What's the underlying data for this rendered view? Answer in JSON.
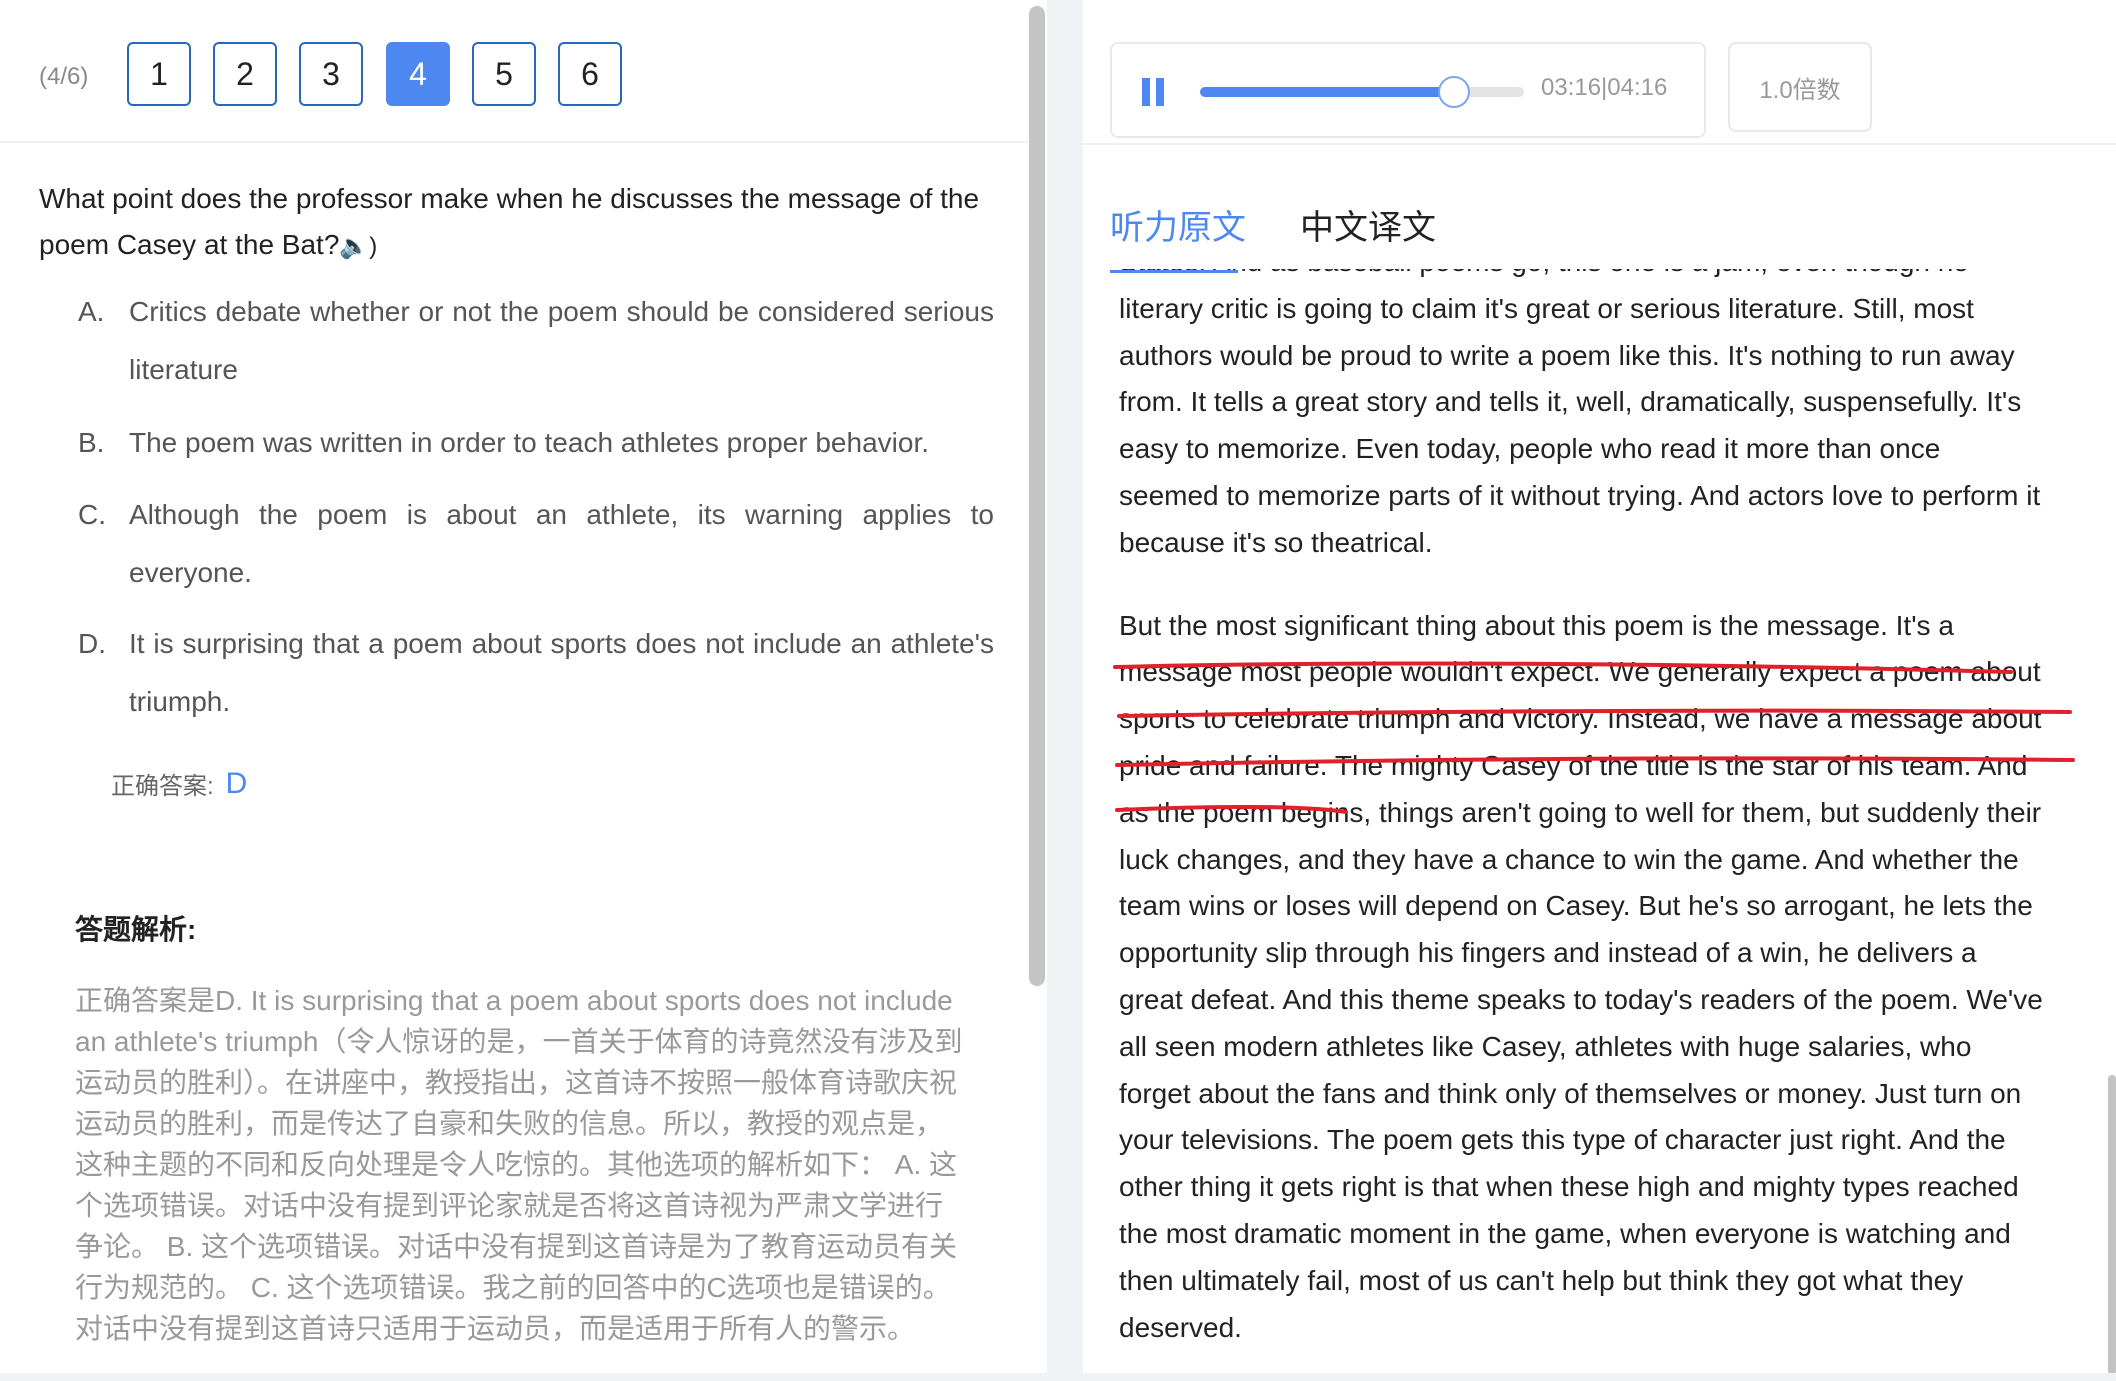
{
  "question_nav": {
    "progress": "(4/6)",
    "buttons": [
      "1",
      "2",
      "3",
      "4",
      "5",
      "6"
    ],
    "active": "4"
  },
  "question": {
    "text": "What point does the professor make when he discusses the message of the poem Casey at the Bat?",
    "speaker_icon": "speaker-icon"
  },
  "options": [
    {
      "letter": "A.",
      "text": "Critics debate whether or not the poem should be considered serious literature"
    },
    {
      "letter": "B.",
      "text": "The poem was written in order to teach athletes proper behavior."
    },
    {
      "letter": "C.",
      "text": "Although the poem is about an athlete, its warning applies to everyone."
    },
    {
      "letter": "D.",
      "text": "It is surprising that a poem about sports does not include an athlete's triumph."
    }
  ],
  "answer": {
    "label": "正确答案:",
    "value": "D"
  },
  "analysis": {
    "heading": "答题解析:",
    "text": "正确答案是D. It is surprising that a poem about sports does not include an athlete's triumph（令人惊讶的是，一首关于体育的诗竟然没有涉及到运动员的胜利）。在讲座中，教授指出，这首诗不按照一般体育诗歌庆祝运动员的胜利，而是传达了自豪和失败的信息。所以，教授的观点是，这种主题的不同和反向处理是令人吃惊的。其他选项的解析如下： A. 这个选项错误。对话中没有提到评论家就是否将这首诗视为严肃文学进行争论。 B. 这个选项错误。对话中没有提到这首诗是为了教育运动员有关行为规范的。 C. 这个选项错误。我之前的回答中的C选项也是错误的。对话中没有提到这首诗只适用于运动员，而是适用于所有人的警示。"
  },
  "player": {
    "time": "03:16|04:16",
    "progress_fraction": 0.785,
    "speed": "1.0倍数",
    "pause_icon": "pause-icon"
  },
  "tabs": [
    "听力原文",
    "中文译文"
  ],
  "active_tab": "听力原文",
  "transcript": {
    "para1": [
      "States. And as baseball poems go, this one is a jam, even though no",
      "literary critic is going to claim it's great or serious literature. Still, most",
      "authors would be proud to write a poem like this. It's nothing to run away",
      "from. It tells a great story and tells it, well, dramatically, suspensefully. It's",
      "easy to memorize. Even today, people who read it more than once",
      "seemed to memorize parts of it without trying. And actors love to perform it",
      "because it's so theatrical."
    ],
    "para2": [
      "But the most significant thing about this poem is the message. It's a",
      "message most people wouldn't expect. We generally expect a poem about",
      "sports to celebrate triumph and victory. Instead, we have a message about",
      "pride and failure. The mighty Casey of the title is the star of his team. And",
      "as the poem begins, things aren't going to well for them, but suddenly their",
      "luck changes, and they have a chance to win the game. And whether the",
      "team wins or loses will depend on Casey. But he's so arrogant, he lets the",
      "opportunity slip through his fingers and instead of a win, he delivers a",
      "great defeat. And this theme speaks to today's readers of the poem. We've",
      "all seen modern athletes like Casey, athletes with huge salaries, who",
      "forget about the fans and think only of themselves or money. Just turn on",
      "your televisions. The poem gets this type of character just right. And the",
      "other thing it gets right is that when these high and mighty types reached",
      "the most dramatic moment in the game, when everyone is watching and",
      "then ultimately fail, most of us can't help but think they got what they",
      "deserved."
    ]
  },
  "colors": {
    "accent": "#4d88f0",
    "annotation_red": "#e0202a",
    "muted_text": "#999999"
  }
}
